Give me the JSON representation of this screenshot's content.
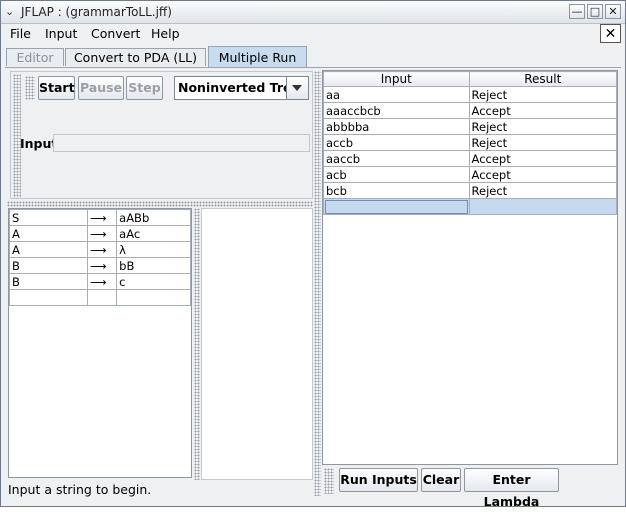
{
  "window": {
    "title": "JFLAP : (grammarToLL.jff)"
  },
  "menu": [
    "File",
    "Input",
    "Convert",
    "Help"
  ],
  "tabs": [
    {
      "label": "Editor",
      "state": "disabled"
    },
    {
      "label": "Convert to PDA (LL)",
      "state": "normal"
    },
    {
      "label": "Multiple Run",
      "state": "selected"
    }
  ],
  "sim_toolbar": {
    "start": "Start",
    "pause": "Pause",
    "step": "Step",
    "view_select": "Noninverted Tree"
  },
  "input_label": "Input",
  "grammar": {
    "arrow": "⟶",
    "rows": [
      {
        "lhs": "S",
        "rhs": "aABb"
      },
      {
        "lhs": "A",
        "rhs": "aAc"
      },
      {
        "lhs": "A",
        "rhs": "λ"
      },
      {
        "lhs": "B",
        "rhs": "bB"
      },
      {
        "lhs": "B",
        "rhs": "c"
      }
    ]
  },
  "results_table": {
    "headers": [
      "Input",
      "Result"
    ],
    "rows": [
      {
        "input": "aa",
        "result": "Reject"
      },
      {
        "input": "aaaccbcb",
        "result": "Accept"
      },
      {
        "input": "abbbba",
        "result": "Reject"
      },
      {
        "input": "accb",
        "result": "Reject"
      },
      {
        "input": "aaccb",
        "result": "Accept"
      },
      {
        "input": "acb",
        "result": "Accept"
      },
      {
        "input": "bcb",
        "result": "Reject"
      }
    ]
  },
  "bottom_buttons": {
    "run": "Run Inputs",
    "clear": "Clear",
    "lambda": "Enter Lambda"
  },
  "status": "Input a string to begin.",
  "colors": {
    "selected_tab": "#c8dcf0",
    "selected_row": "#c6d9ee",
    "accent_border": "#6f7a8c"
  }
}
